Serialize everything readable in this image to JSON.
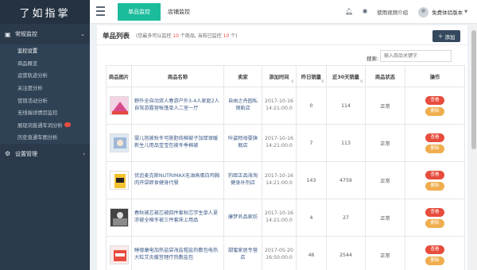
{
  "brand": "了如指掌",
  "sidebar": {
    "groups": [
      {
        "label": "常规监控",
        "icon": "monitor-icon"
      },
      {
        "label": "设置管理",
        "icon": "gear-icon"
      }
    ],
    "items": [
      {
        "label": "监控设置"
      },
      {
        "label": "商品概览"
      },
      {
        "label": "运营轨迹分析"
      },
      {
        "label": "关注度分析"
      },
      {
        "label": "营销活动分析"
      },
      {
        "label": "无线端详情页监控"
      },
      {
        "label": "展现词直通车词分析"
      },
      {
        "label": "历史直通车图分析"
      }
    ]
  },
  "topbar": {
    "tabs": [
      {
        "label": "单品监控"
      },
      {
        "label": "店铺监控"
      }
    ],
    "help": "使用视频介绍",
    "user": "免费体验版本"
  },
  "panel": {
    "title": "单品列表",
    "sub_prefix": "(您最多可以监控",
    "limit": "10",
    "sub_mid": "个商品, 当前已监控",
    "current": "10",
    "sub_suffix": "个)",
    "add_label": "添加",
    "search_label": "搜索:",
    "search_placeholder": "输入商品关键字"
  },
  "table": {
    "headers": [
      "商品图片",
      "商品名称",
      "卖家",
      "添加时间",
      "昨日销量",
      "近30天销量",
      "商品状态",
      "操作"
    ],
    "view_label": "查看",
    "delete_label": "删除",
    "rows": [
      {
        "name": "野外全自动双人春游户外3-4人家庭2人自驾游露营帐篷单人二室一厅",
        "shop": "自由之舟园私钢舶店",
        "date": "2017-10-16",
        "time": "14:21:00.0",
        "yesterday": "0",
        "month": "114",
        "status": "正常"
      },
      {
        "name": "婴儿抱被秋冬可脱胆纯棉被子加厚保暖新生儿用品宝宝包被冬季棉被",
        "shop": "咔姿籾母婴旗舰店",
        "date": "2017-10-16",
        "time": "14:21:00.0",
        "yesterday": "7",
        "month": "113",
        "status": "正常"
      },
      {
        "name": "优追麦克斯NUTRIMAX无油高蛋白鸡胸肉开袋即食健身代餐",
        "shop": "豹距正品海淘健身补剂店",
        "date": "2017-10-16",
        "time": "14:21:00.0",
        "yesterday": "143",
        "month": "4759",
        "status": "正常"
      },
      {
        "name": "春秋被芯被芯被四件套秋芯学生单人夏凉被全棉冬被三件套床上用品",
        "shop": "康梦名品家纺",
        "date": "2017-10-16",
        "time": "14:21:00.0",
        "yesterday": "4",
        "month": "27",
        "status": "正常"
      },
      {
        "name": "睡德康电加热盐袋海盐粗盐热敷包电热大粒艾灸暖宫理疗热敷盐包",
        "shop": "甜蜜家居专营店",
        "date": "2017-05-20",
        "time": "16:50:00.0",
        "yesterday": "46",
        "month": "2544",
        "status": "正常"
      }
    ]
  },
  "colors": {
    "sidebar": "#2b3a4a",
    "accent": "#1abc9c",
    "view": "#e74c3c",
    "delete": "#f0ad4e",
    "add": "#34495e"
  }
}
